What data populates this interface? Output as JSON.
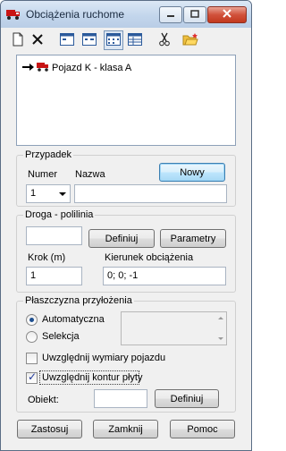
{
  "window": {
    "title": "Obciążenia ruchome"
  },
  "toolbar": {
    "icons": [
      "new-icon",
      "delete-icon",
      "view1-icon",
      "view2-icon",
      "view3-icon",
      "table-icon",
      "scissors-icon",
      "folder-icon"
    ]
  },
  "tree": {
    "item_label": "Pojazd K - klasa A"
  },
  "przypadek": {
    "title": "Przypadek",
    "numer_label": "Numer",
    "nazwa_label": "Nazwa",
    "numer_value": "1",
    "nazwa_value": "",
    "new_button": "Nowy"
  },
  "droga": {
    "title": "Droga - polilinia",
    "value": "",
    "define_button": "Definiuj",
    "params_button": "Parametry",
    "krok_label": "Krok  (m)",
    "krok_value": "1",
    "kierunek_label": "Kierunek obciążenia",
    "kierunek_value": "0; 0; -1"
  },
  "plaszczyzna": {
    "title": "Płaszczyzna przyłożenia",
    "radio_auto": "Automatyczna",
    "radio_sel": "Selekcja",
    "check_wymiary": "Uwzględnij wymiary pojazdu",
    "check_kontur": "Uwzględnij kontur płyty",
    "obiekt_label": "Obiekt:",
    "obiekt_value": "",
    "define_button": "Definiuj"
  },
  "footer": {
    "apply": "Zastosuj",
    "close": "Zamknij",
    "help": "Pomoc"
  },
  "colors": {
    "vehicle_red": "#c81414",
    "accent_blue": "#3c7fb1"
  }
}
